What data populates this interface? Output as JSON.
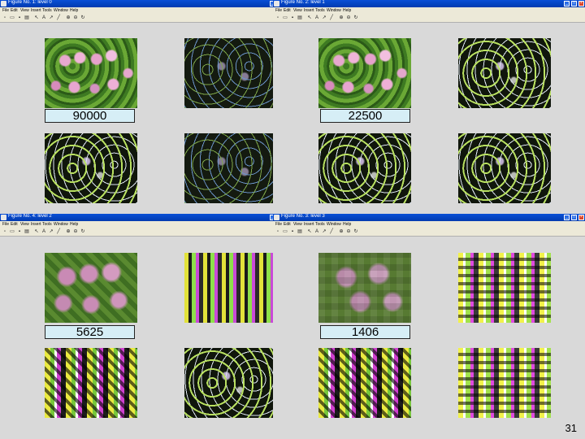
{
  "windows": [
    {
      "title": "Figure No. 1: level 0",
      "label": "90000"
    },
    {
      "title": "Figure No. 2: level 1",
      "label": "22500"
    },
    {
      "title": "Figure No. 4: level 2",
      "label": "5625"
    },
    {
      "title": "Figure No. 3: level 3",
      "label": "1406"
    }
  ],
  "menu": [
    "File",
    "Edit",
    "View",
    "Insert",
    "Tools",
    "Window",
    "Help"
  ],
  "toolbar_icons": [
    "new-icon",
    "open-icon",
    "save-icon",
    "print-icon",
    "arrow-icon",
    "text-icon",
    "line-icon",
    "zoom-in-icon",
    "zoom-out-icon",
    "rotate-icon"
  ],
  "window_buttons": {
    "minimize": "_",
    "maximize": "□",
    "close": "×"
  },
  "page_number": "31"
}
